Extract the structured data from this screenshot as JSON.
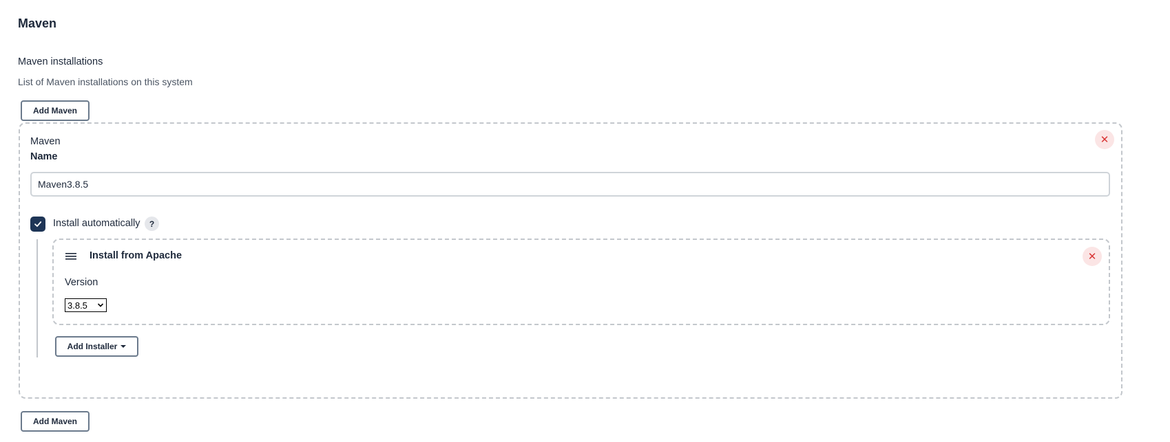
{
  "section": {
    "title": "Maven",
    "field_label": "Maven installations",
    "field_description": "List of Maven installations on this system",
    "add_button_label": "Add Maven"
  },
  "installation": {
    "header": "Maven",
    "name_label": "Name",
    "name_value": "Maven3.8.5",
    "close_icon": "close-icon",
    "install_automatically": {
      "label": "Install automatically",
      "checked": true,
      "help_text": "?"
    },
    "installer": {
      "title": "Install from Apache",
      "drag_icon": "drag-handle-icon",
      "version_label": "Version",
      "version_selected": "3.8.5"
    },
    "add_installer_label": "Add Installer"
  },
  "colors": {
    "checkbox_bg": "#1e3556",
    "close_icon": "#d93636",
    "close_bg": "#fbe5e5",
    "border_dashed": "#c3c7cc",
    "button_border": "#6b7a8c"
  }
}
